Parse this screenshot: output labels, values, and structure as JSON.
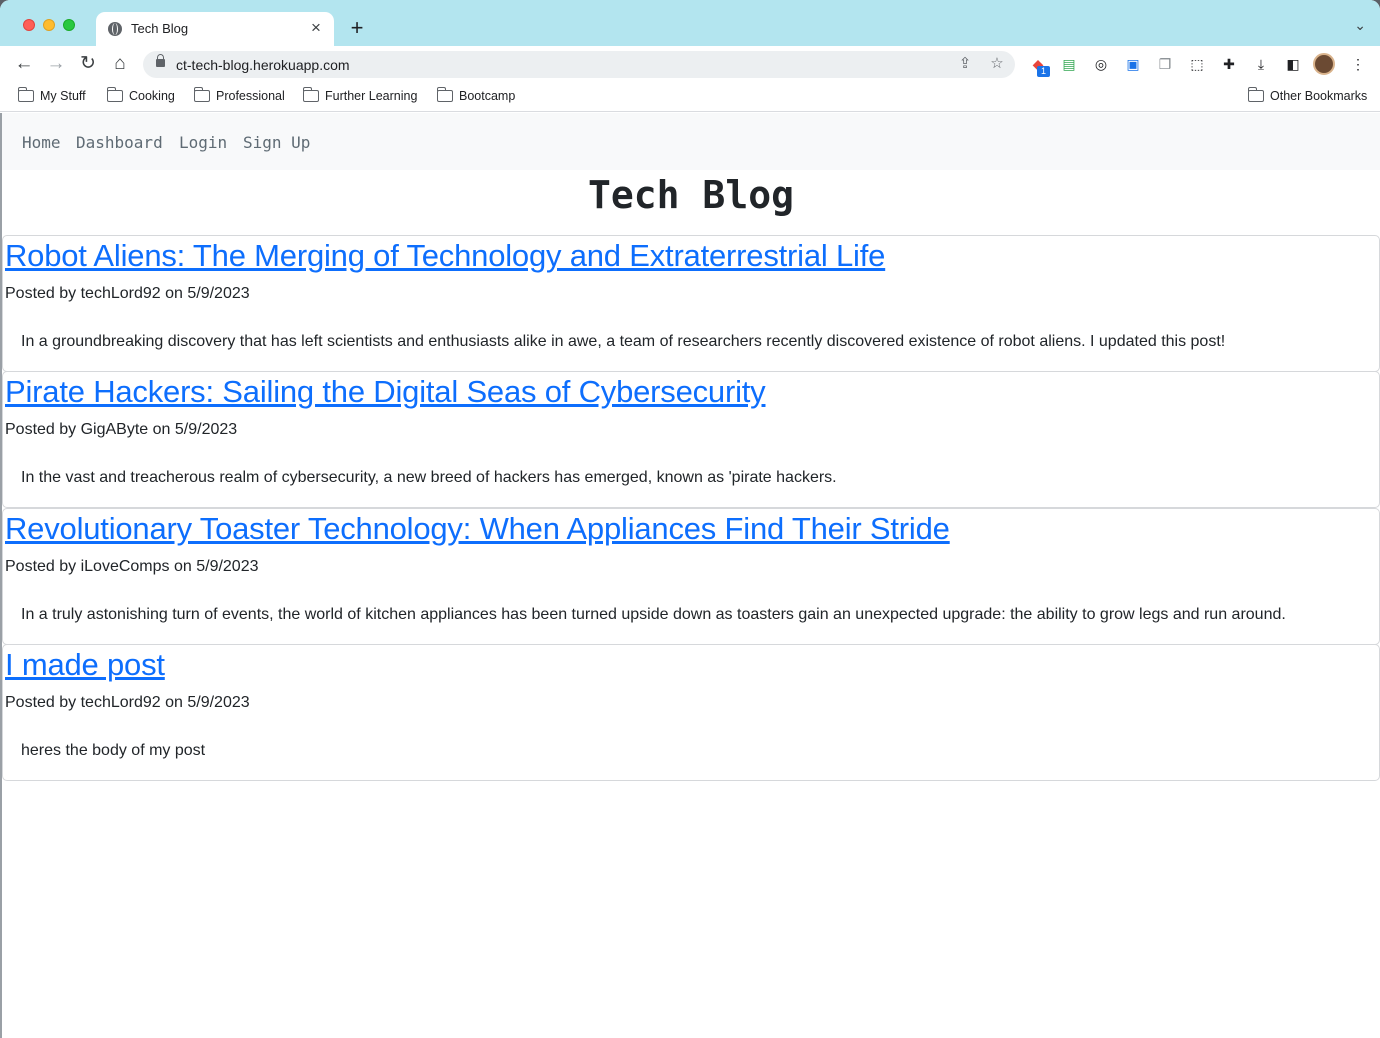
{
  "browser": {
    "tab_title": "Tech Blog",
    "tab_close": "×",
    "new_tab": "+",
    "url": "ct-tech-blog.herokuapp.com",
    "extension_badge": "1",
    "bookmarks": [
      "My Stuff",
      "Cooking",
      "Professional",
      "Further Learning",
      "Bootcamp"
    ],
    "other_bookmarks": "Other Bookmarks"
  },
  "nav": {
    "home": "Home",
    "dashboard": "Dashboard",
    "login": "Login",
    "signup": "Sign Up"
  },
  "site_title": "Tech Blog",
  "posts": [
    {
      "title": "Robot Aliens: The Merging of Technology and Extraterrestrial Life",
      "meta": "Posted by techLord92 on 5/9/2023",
      "body": "In a groundbreaking discovery that has left scientists and enthusiasts alike in awe, a team of researchers recently discovered existence of robot aliens. I updated this post!"
    },
    {
      "title": "Pirate Hackers: Sailing the Digital Seas of Cybersecurity",
      "meta": "Posted by GigAByte on 5/9/2023",
      "body": "In the vast and treacherous realm of cybersecurity, a new breed of hackers has emerged, known as 'pirate hackers."
    },
    {
      "title": "Revolutionary Toaster Technology: When Appliances Find Their Stride",
      "meta": "Posted by iLoveComps on 5/9/2023",
      "body": "In a truly astonishing turn of events, the world of kitchen appliances has been turned upside down as toasters gain an unexpected upgrade: the ability to grow legs and run around."
    },
    {
      "title": "I made post",
      "meta": "Posted by techLord92 on 5/9/2023",
      "body": "heres the body of my post"
    }
  ],
  "colors": {
    "link": "#0d6efd",
    "navbar_bg": "#f8f9fa",
    "tabstrip_bg": "#b3e5ef"
  }
}
